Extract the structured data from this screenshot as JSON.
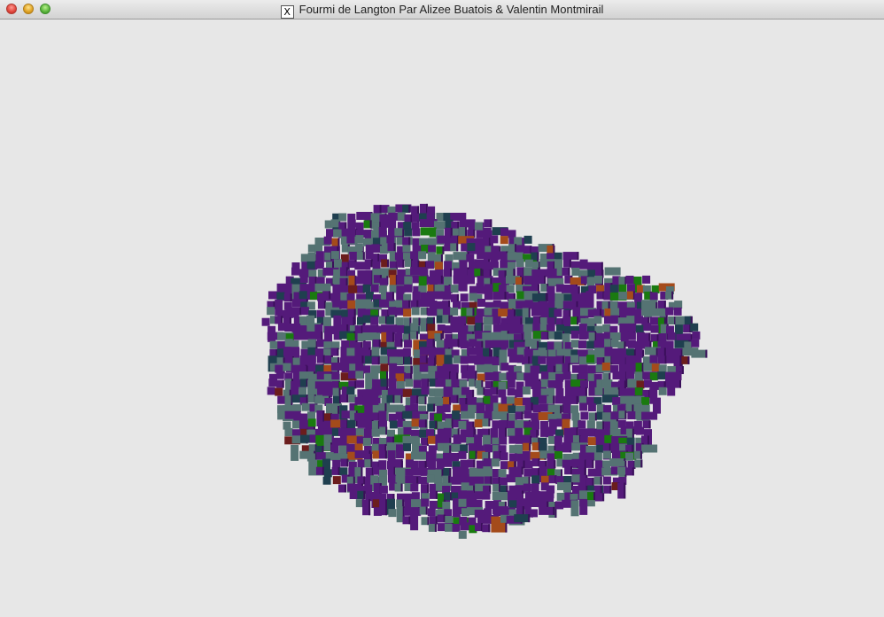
{
  "window": {
    "title": "Fourmi de Langton Par Alizee Buatois & Valentin Montmirail",
    "title_icon": "x11-icon",
    "controls": [
      "close-icon",
      "minimize-icon",
      "zoom-icon"
    ]
  },
  "scene": {
    "background": "#e7e7e7",
    "colors": {
      "purple": "#541a7a",
      "teal": "#557373",
      "dark_teal": "#1f3f4f",
      "green": "#1a7a10",
      "orange": "#a44b1b",
      "dark_red": "#6b1d1d"
    }
  }
}
